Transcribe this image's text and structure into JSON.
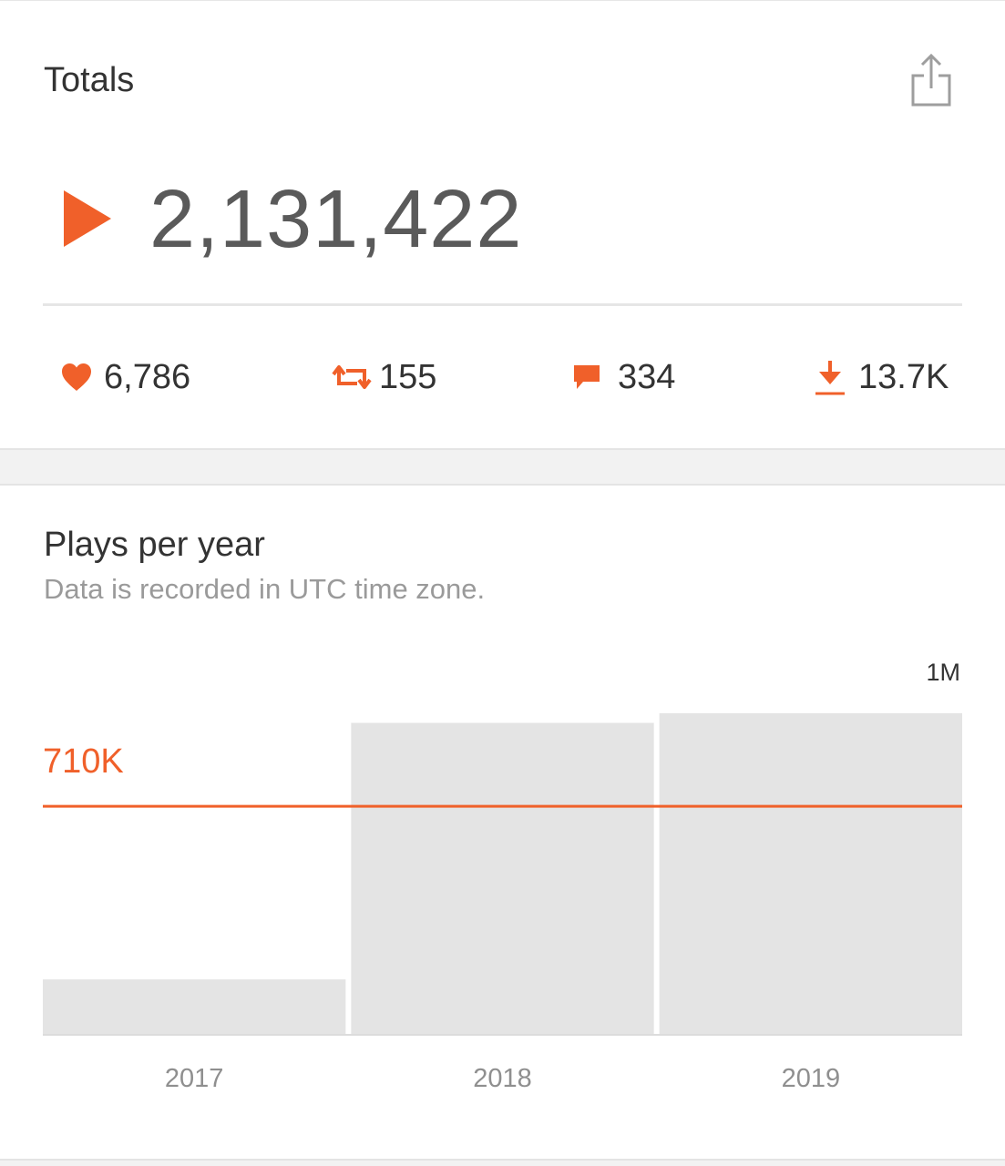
{
  "totals": {
    "title": "Totals",
    "share_icon": "share-icon",
    "play_icon": "play-icon",
    "plays": "2,131,422",
    "stats": {
      "likes": "6,786",
      "reposts": "155",
      "comments": "334",
      "downloads": "13.7K"
    }
  },
  "colors": {
    "accent": "#f0602a",
    "bar": "#e4e4e4",
    "text": "#333333",
    "muted": "#9a9a9a"
  },
  "plays_chart": {
    "title": "Plays per year",
    "subtitle": "Data is recorded in UTC time zone."
  },
  "chart_data": {
    "type": "bar",
    "categories": [
      "2017",
      "2018",
      "2019"
    ],
    "values": [
      170000,
      970000,
      1000000
    ],
    "ylim": [
      0,
      1000000
    ],
    "y_max_label": "1M",
    "reference_line": {
      "value": 710000,
      "label": "710K"
    },
    "grid": false,
    "legend": "none"
  }
}
